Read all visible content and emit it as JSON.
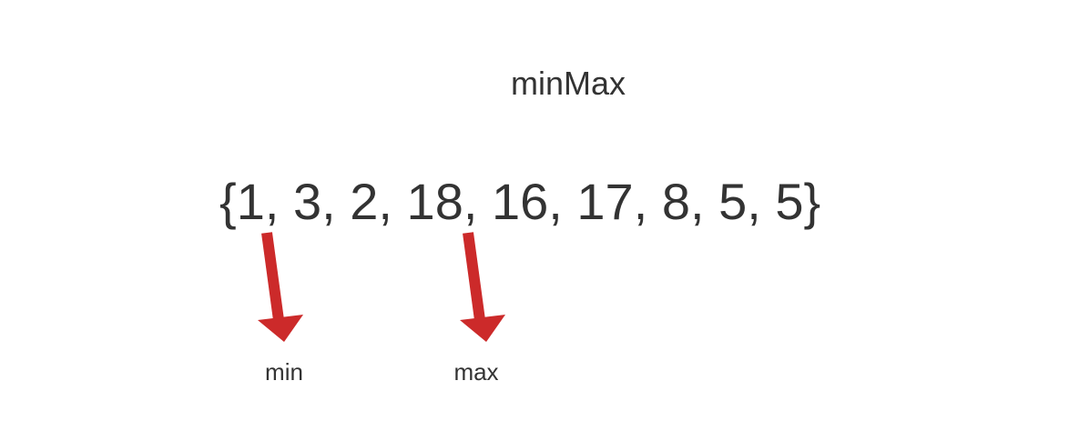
{
  "title": "minMax",
  "array": {
    "open_brace": "{",
    "close_brace": "}",
    "separator": ", ",
    "values": [
      "1",
      "3",
      "2",
      "18",
      "16",
      "17",
      "8",
      "5",
      "5"
    ]
  },
  "pointers": [
    {
      "label": "min",
      "target_value": "1"
    },
    {
      "label": "max",
      "target_value": "18"
    }
  ],
  "colors": {
    "text": "#333333",
    "arrow": "#cc2a2a",
    "background": "#ffffff"
  }
}
